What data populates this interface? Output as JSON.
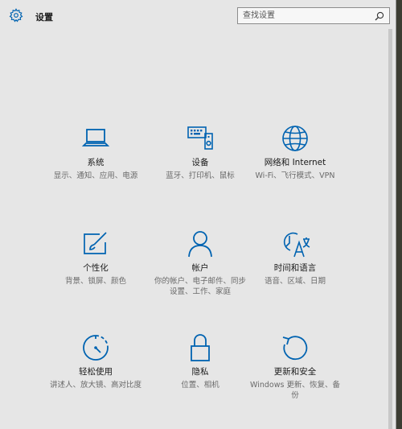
{
  "window": {
    "title": "设置"
  },
  "search": {
    "placeholder": "查找设置"
  },
  "tiles": [
    {
      "name": "系统",
      "desc": "显示、通知、应用、电源",
      "icon": "laptop-icon"
    },
    {
      "name": "设备",
      "desc": "蓝牙、打印机、鼠标",
      "icon": "devices-icon"
    },
    {
      "name": "网络和 Internet",
      "desc": "Wi-Fi、飞行模式、VPN",
      "icon": "globe-icon"
    },
    {
      "name": "个性化",
      "desc": "背景、锁屏、颜色",
      "icon": "paintbrush-icon"
    },
    {
      "name": "帐户",
      "desc": "你的帐户、电子邮件、同步设置、工作、家庭",
      "icon": "person-icon"
    },
    {
      "name": "时间和语言",
      "desc": "语音、区域、日期",
      "icon": "time-language-icon"
    },
    {
      "name": "轻松使用",
      "desc": "讲述人、放大镜、高对比度",
      "icon": "ease-of-access-icon"
    },
    {
      "name": "隐私",
      "desc": "位置、相机",
      "icon": "lock-icon"
    },
    {
      "name": "更新和安全",
      "desc": "Windows 更新、恢复、备份",
      "icon": "refresh-icon"
    }
  ],
  "colors": {
    "accent": "#0063b1",
    "background": "#e6e6e6"
  }
}
